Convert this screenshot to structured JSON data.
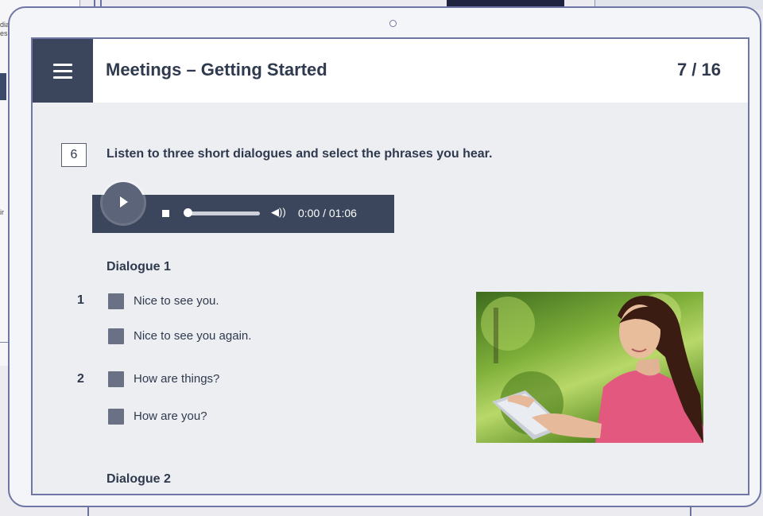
{
  "background": {
    "left_fragments": [
      "dia",
      "es",
      "ir"
    ]
  },
  "header": {
    "title": "Meetings – Getting Started",
    "page_counter": "7 / 16",
    "menu_icon": "hamburger-menu-icon"
  },
  "exercise": {
    "number": "6",
    "instruction": "Listen to three short dialogues and select the phrases you hear."
  },
  "audio_player": {
    "play_icon": "play-icon",
    "stop_icon": "stop-icon",
    "volume_icon": "volume-icon",
    "volume_glyph": "◀))",
    "time": "0:00 / 01:06",
    "progress": 0
  },
  "dialogue1": {
    "heading": "Dialogue 1",
    "items": [
      {
        "number": "1",
        "options": [
          "Nice to see you.",
          "Nice to see you again."
        ]
      },
      {
        "number": "2",
        "options": [
          "How are things?",
          "How are you?"
        ]
      }
    ]
  },
  "dialogue2": {
    "heading": "Dialogue 2"
  },
  "colors": {
    "header_dark": "#3b465c",
    "frame": "#6f76a6",
    "text": "#2f3a4f",
    "checkbox": "#6a7184"
  }
}
